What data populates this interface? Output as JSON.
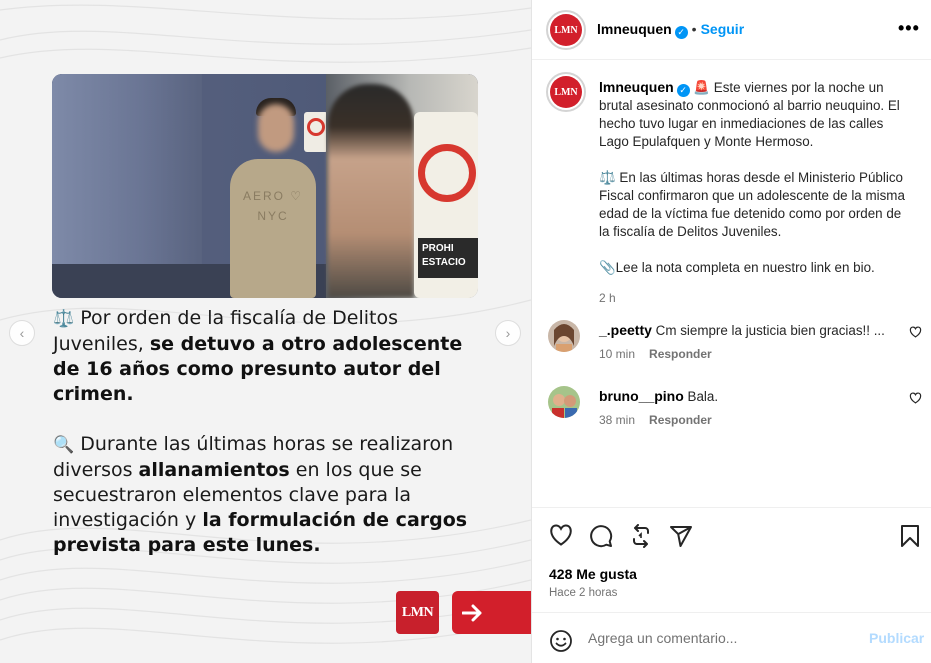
{
  "slide": {
    "photo_hoodie_text": "AERO ♡ NYC",
    "photo_sign_text": "PROHI ESTACIO",
    "paragraph1": {
      "icon": "⚖️",
      "plain": " Por orden de la fiscalía de Delitos Juveniles, ",
      "bold": "se detuvo a otro adolescente de 16 años como presunto autor del crimen."
    },
    "paragraph2": {
      "icon": "🔍",
      "plain1": " Durante las últimas horas se realizaron diversos ",
      "bold1": "allanamientos",
      "plain2": " en los que se secuestraron elementos clave para la investigación y ",
      "bold2": "la formulación de cargos prevista para este lunes."
    },
    "logo_text": "LMN",
    "prev_symbol": "‹",
    "next_symbol": "›",
    "arrow_symbol": "➔"
  },
  "header": {
    "avatar_text": "LMN",
    "username": "lmneuquen",
    "verified_symbol": "✓",
    "separator": "•",
    "follow_label": "Seguir",
    "more_symbol": "•••"
  },
  "caption": {
    "username": "lmneuquen",
    "p1": "🚨 Este viernes por la noche un brutal asesinato conmocionó al barrio neuquino. El hecho tuvo lugar en inmediaciones de las calles Lago Epulafquen y Monte Hermoso.",
    "p2": "⚖️ En las últimas horas desde el Ministerio Público Fiscal confirmaron que un adolescente de la misma edad de la víctima fue detenido como por orden de la fiscalía de Delitos Juveniles.",
    "p3": "📎Lee la nota completa en nuestro link en bio.",
    "time": "2 h"
  },
  "comments": [
    {
      "username": "_.peetty",
      "text": "Cm siempre la justicia bien gracias!! ...",
      "time": "10 min",
      "reply": "Responder"
    },
    {
      "username": "bruno__pino",
      "text": "Bala.",
      "time": "38 min",
      "reply": "Responder"
    }
  ],
  "stats": {
    "likes": "428 Me gusta",
    "ago": "Hace 2 horas"
  },
  "add_comment": {
    "placeholder": "Agrega un comentario...",
    "publish_label": "Publicar"
  },
  "colors": {
    "brand_red": "#d21f2b",
    "link_blue": "#0095f6",
    "publish_disabled": "#b3dbff",
    "muted": "#737373"
  }
}
